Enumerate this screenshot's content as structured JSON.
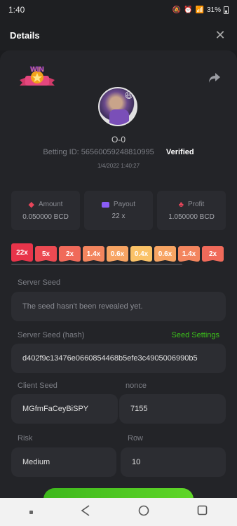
{
  "status_bar": {
    "time": "1:40",
    "battery": "31%"
  },
  "header": {
    "title": "Details",
    "close_icon": "close-icon"
  },
  "bet": {
    "username": "O-0",
    "betting_id_label": "Betting ID: 56560059248810995",
    "verified": "Verified",
    "datetime": "1/4/2022 1:40:27",
    "badge_text": "WIN"
  },
  "stats": [
    {
      "label": "Amount",
      "value": "0.050000 BCD"
    },
    {
      "label": "Payout",
      "value": "22 x"
    },
    {
      "label": "Profit",
      "value": "1.050000 BCD"
    }
  ],
  "multipliers": [
    {
      "label": "22x",
      "color": "#e8344a",
      "active": true
    },
    {
      "label": "5x",
      "color": "#ec4a52"
    },
    {
      "label": "2x",
      "color": "#f06a5a"
    },
    {
      "label": "1.4x",
      "color": "#f3855e"
    },
    {
      "label": "0.6x",
      "color": "#f7a463"
    },
    {
      "label": "0.4x",
      "color": "#fac267"
    },
    {
      "label": "0.6x",
      "color": "#f7a463"
    },
    {
      "label": "1.4x",
      "color": "#f3855e"
    },
    {
      "label": "2x",
      "color": "#f06a5a"
    }
  ],
  "server_seed": {
    "label": "Server Seed",
    "value": "The seed hasn't been revealed yet."
  },
  "server_seed_hash": {
    "label": "Server Seed (hash)",
    "link": "Seed Settings",
    "value": "d402f9c13476e0660854468b5efe3c4905006990b5"
  },
  "client_seed": {
    "label": "Client Seed",
    "value": "MGfmFaCeyBiSPY"
  },
  "nonce": {
    "label": "nonce",
    "value": "7155"
  },
  "risk": {
    "label": "Risk",
    "value": "Medium"
  },
  "row": {
    "label": "Row",
    "value": "10"
  },
  "colors": {
    "accent_green": "#3cc21a",
    "background": "#1b1c1f",
    "card": "#232428"
  }
}
